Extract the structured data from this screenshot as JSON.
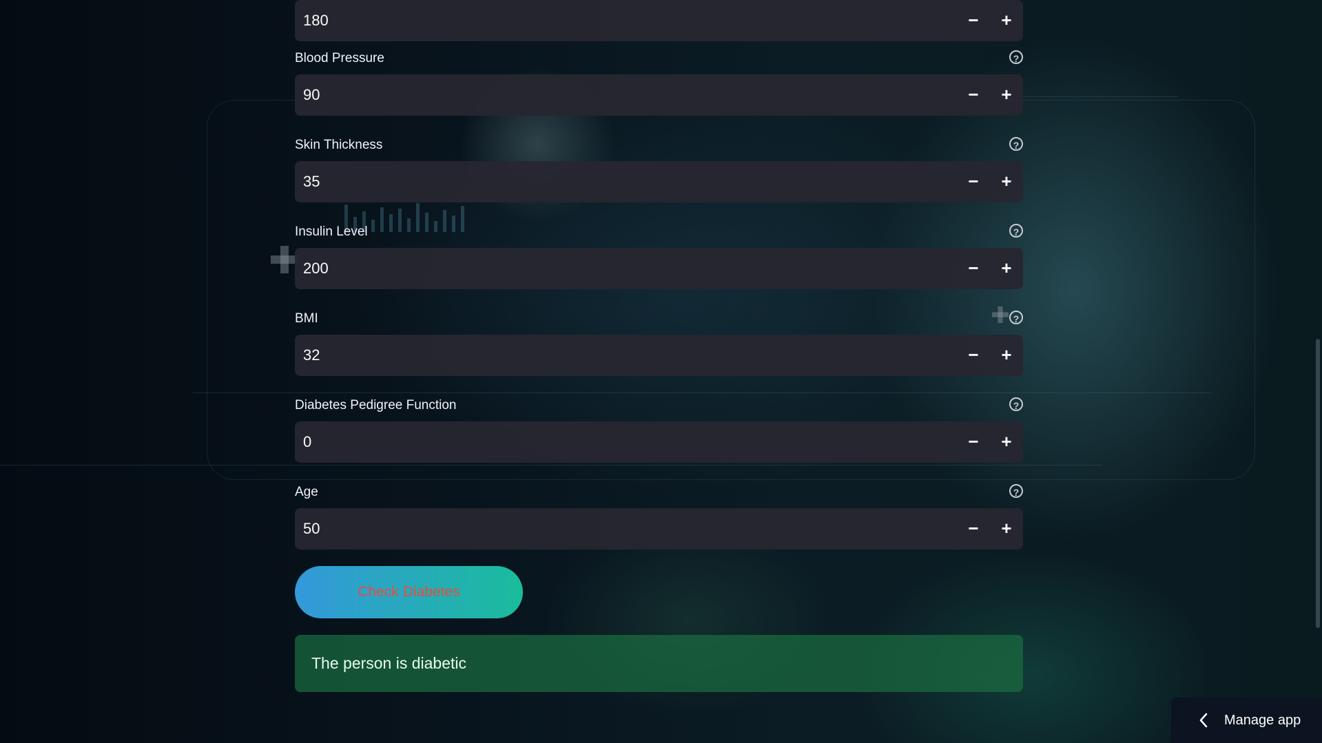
{
  "fields": [
    {
      "label": "",
      "value": "180"
    },
    {
      "label": "Blood Pressure",
      "value": "90"
    },
    {
      "label": "Skin Thickness",
      "value": "35"
    },
    {
      "label": "Insulin Level",
      "value": "200"
    },
    {
      "label": "BMI",
      "value": "32"
    },
    {
      "label": "Diabetes Pedigree Function",
      "value": "0"
    },
    {
      "label": "Age",
      "value": "50"
    }
  ],
  "stepper": {
    "minus": "−",
    "plus": "+"
  },
  "help_icon": {
    "glyph": "?",
    "icon": "question-circle-icon"
  },
  "check_button": {
    "label": "Check Diabetes"
  },
  "result": {
    "text": "The person is diabetic"
  },
  "manage_app": {
    "label": "Manage app",
    "icon": "chevron-left-icon"
  },
  "colors": {
    "button_gradient_start": "#3498db",
    "button_gradient_end": "#1abc9c",
    "button_text": "#e74c3c",
    "success_bg": "#1a6c40",
    "input_bg": "#262730"
  }
}
